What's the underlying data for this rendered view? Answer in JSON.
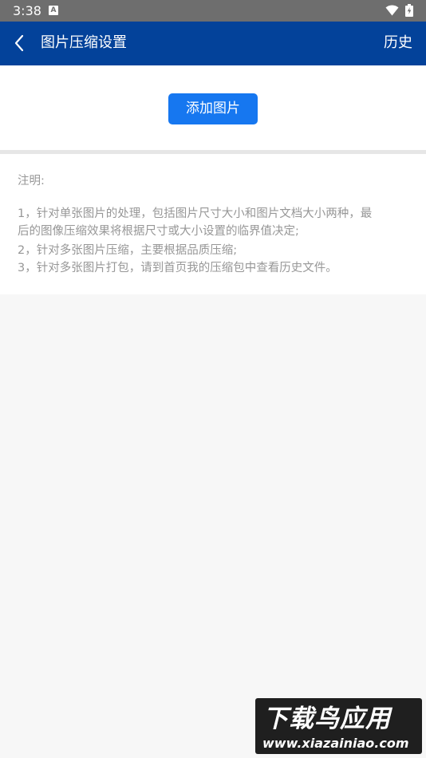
{
  "status_bar": {
    "time": "3:38",
    "notification_icon_label": "A",
    "icons": [
      "a-notification-icon",
      "wifi-icon",
      "battery-charging-icon"
    ]
  },
  "app_bar": {
    "back_icon": "back-icon",
    "title": "图片压缩设置",
    "history_label": "历史",
    "color": "#03429a"
  },
  "main": {
    "add_image_label": "添加图片",
    "button_color": "#1677f0"
  },
  "notes": {
    "title": "注明:",
    "lines": [
      "1，针对单张图片的处理，包括图片尺寸大小和图片文档大小两种，最",
      "后的图像压缩效果将根据尺寸或大小设置的临界值决定;",
      "2，针对多张图片压缩，主要根据品质压缩;",
      "3，针对多张图片打包，请到首页我的压缩包中查看历史文件。"
    ]
  },
  "watermark": {
    "top": "下载鸟应用",
    "bottom": "www.xiazainiao.com"
  }
}
